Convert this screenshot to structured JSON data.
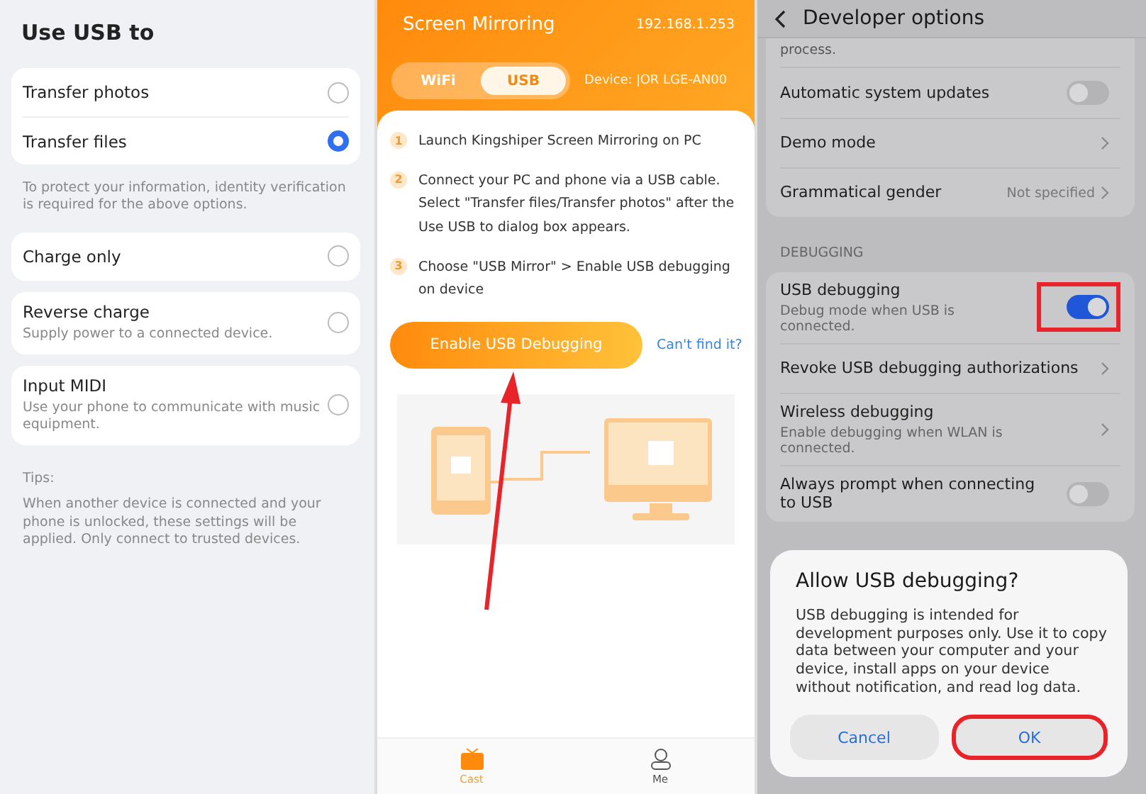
{
  "usb_panel": {
    "title": "Use USB to",
    "groups": [
      {
        "options": [
          {
            "label": "Transfer photos",
            "selected": false
          },
          {
            "label": "Transfer files",
            "selected": true
          }
        ],
        "note": "To protect your information, identity verification is required for the above options."
      },
      {
        "options": [
          {
            "label": "Charge only",
            "selected": false
          }
        ]
      },
      {
        "options": [
          {
            "label": "Reverse charge",
            "description": "Supply power to a connected device.",
            "selected": false
          }
        ]
      },
      {
        "options": [
          {
            "label": "Input MIDI",
            "description": "Use your phone to communicate with music equipment.",
            "selected": false
          }
        ]
      }
    ],
    "tips_title": "Tips:",
    "tips": "When another device is connected and your phone is unlocked, these settings will be applied. Only connect to trusted devices."
  },
  "mirror_panel": {
    "title": "Screen Mirroring",
    "ip": "192.168.1.253",
    "tabs": [
      {
        "label": "WiFi",
        "selected": false
      },
      {
        "label": "USB",
        "selected": true
      }
    ],
    "device": "Device: ǀOR  LGE-AN00",
    "steps": [
      {
        "number": "1",
        "text": "Launch Kingshiper Screen Mirroring on PC"
      },
      {
        "number": "2",
        "text": "Connect your PC and phone via a USB cable. Select \"Transfer files/Transfer photos\" after the Use USB to dialog box appears."
      },
      {
        "number": "3",
        "text": "Choose \"USB Mirror\" > Enable USB debugging on device"
      }
    ],
    "primary_button": "Enable USB Debugging",
    "help_link": "Can't find it?",
    "nav": [
      {
        "label": "Cast",
        "kind": "cast",
        "selected": true
      },
      {
        "label": "Me",
        "kind": "me",
        "selected": false
      }
    ]
  },
  "developer_panel": {
    "title": "Developer options",
    "clipped_text": "process.",
    "rows": [
      {
        "kind": "toggle",
        "label": "Automatic system updates",
        "on": false
      },
      {
        "kind": "link",
        "label": "Demo mode"
      },
      {
        "kind": "link",
        "label": "Grammatical gender",
        "value": "Not specified"
      }
    ],
    "section": "DEBUGGING",
    "debug_rows": [
      {
        "kind": "toggle",
        "label": "USB debugging",
        "description": "Debug mode when USB is connected.",
        "on": true,
        "highlighted": true
      },
      {
        "kind": "link",
        "label": "Revoke USB debugging authorizations",
        "highlighted": false
      },
      {
        "kind": "link",
        "label": "Wireless debugging",
        "description": "Enable debugging when WLAN is connected.",
        "highlighted": false
      },
      {
        "kind": "toggle",
        "label": "Always prompt when connecting to USB",
        "on": false,
        "highlighted": false
      }
    ],
    "dialog": {
      "title": "Allow USB debugging?",
      "body": "USB debugging is intended for development purposes only. Use it to copy data between your computer and your device, install apps on your device without notification, and read log data.",
      "buttons": [
        {
          "label": "Cancel",
          "highlighted": false
        },
        {
          "label": "OK",
          "highlighted": true
        }
      ]
    }
  }
}
